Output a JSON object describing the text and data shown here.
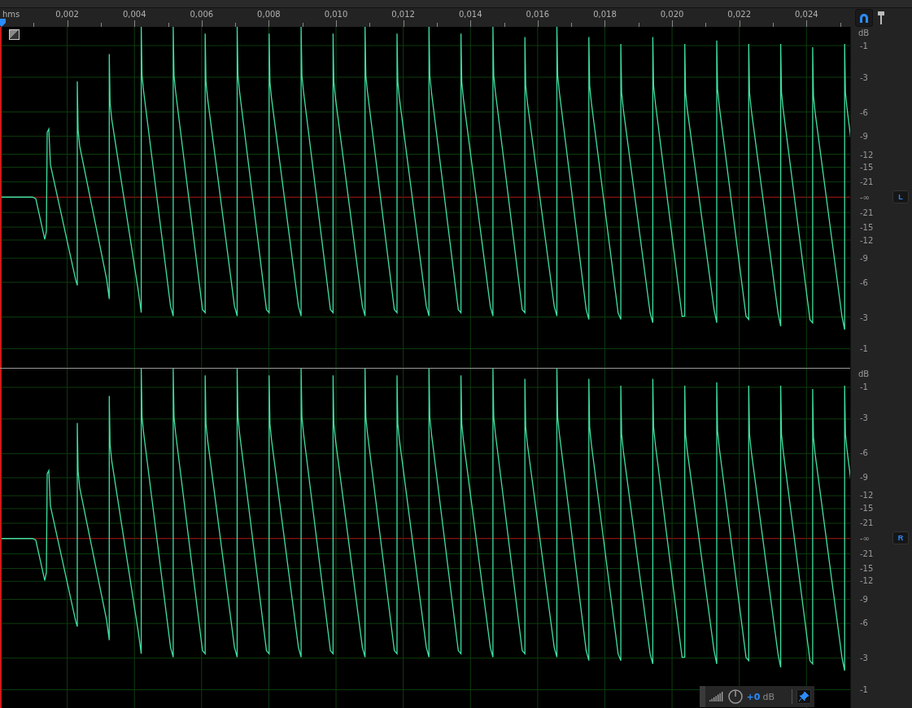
{
  "ruler": {
    "unit": "hms",
    "ticks": [
      "0,002",
      "0,004",
      "0,006",
      "0,008",
      "0,010",
      "0,012",
      "0,014",
      "0,016",
      "0,018",
      "0,020",
      "0,022",
      "0,024"
    ]
  },
  "channels": [
    {
      "label": "L",
      "unit": "dB",
      "scale": [
        "-1",
        "-3",
        "-6",
        "-9",
        "-12",
        "-15",
        "-21",
        "-∞",
        "-21",
        "-15",
        "-12",
        "-9",
        "-6",
        "-3",
        "-1"
      ]
    },
    {
      "label": "R",
      "unit": "dB",
      "scale": [
        "-1",
        "-3",
        "-6",
        "-9",
        "-12",
        "-15",
        "-21",
        "-∞",
        "-21",
        "-15",
        "-12",
        "-9",
        "-6",
        "-3",
        "-1"
      ]
    }
  ],
  "hud": {
    "gain": "+0",
    "unit": "dB"
  }
}
